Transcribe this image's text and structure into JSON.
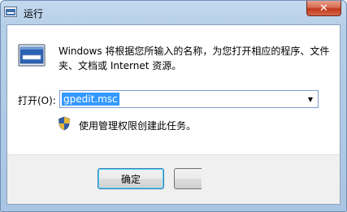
{
  "window": {
    "title": "运行",
    "close_glyph": "✕"
  },
  "dialog": {
    "description": "Windows 将根据您所输入的名称，为您打开相应的程序、文件夹、文档或 Internet 资源。",
    "open_label": "打开(O):",
    "input_value": "gpedit.msc",
    "admin_note": "使用管理权限创建此任务。",
    "ok_label": "确定",
    "cancel_label": ""
  },
  "icons": {
    "title": "run-app-icon",
    "main": "run-app-icon",
    "shield": "uac-shield-icon",
    "dropdown": "chevron-down-icon"
  },
  "colors": {
    "selection": "#3399ff",
    "close_button": "#c1391b",
    "frame": "#a9c5e3"
  }
}
